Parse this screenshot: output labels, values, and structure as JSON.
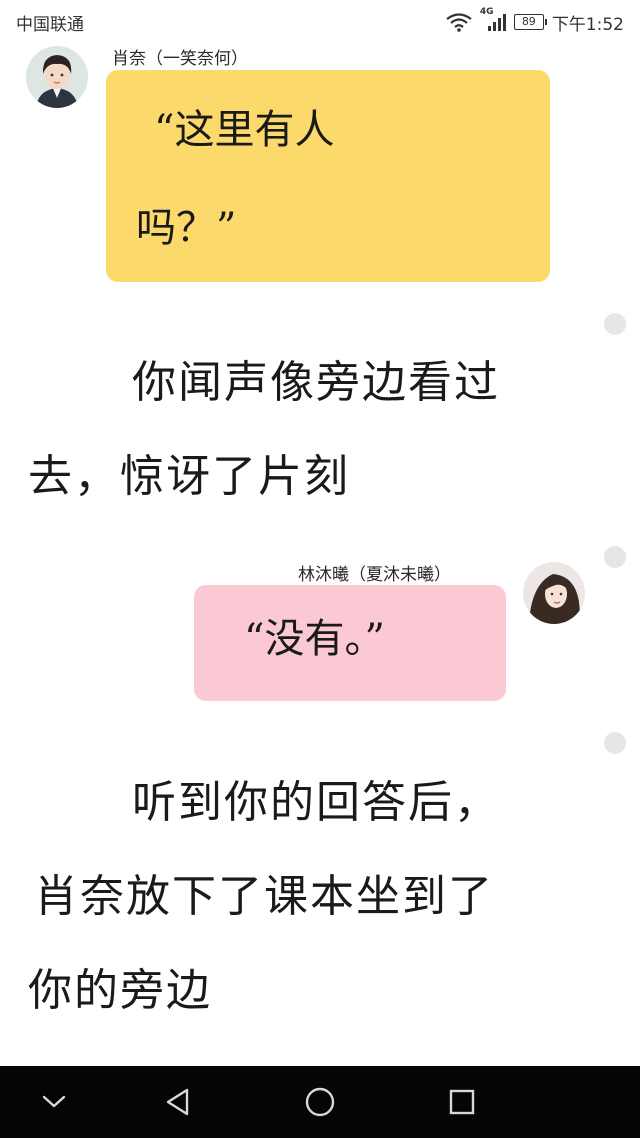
{
  "status_bar": {
    "carrier": "中国联通",
    "network_type": "4G",
    "battery": "89",
    "time": "下午1:52"
  },
  "messages": [
    {
      "sender": "肖奈（一笑奈何）",
      "side": "left",
      "bubble_color": "#fcd96b",
      "lines": [
        "“这里有人",
        "吗？”"
      ]
    },
    {
      "sender": "林沐曦（夏沐未曦）",
      "side": "right",
      "bubble_color": "#fbc9d3",
      "lines": [
        "“没有。”"
      ]
    }
  ],
  "narration": [
    {
      "lines": [
        "你闻声像旁边看过",
        "去，惊讶了片刻"
      ]
    },
    {
      "lines": [
        "听到你的回答后，",
        "肖奈放下了课本坐到了",
        "你的旁边"
      ]
    }
  ],
  "nav_bar": {
    "icons": [
      "chevron-down-icon",
      "back-icon",
      "home-icon",
      "recents-icon"
    ]
  }
}
